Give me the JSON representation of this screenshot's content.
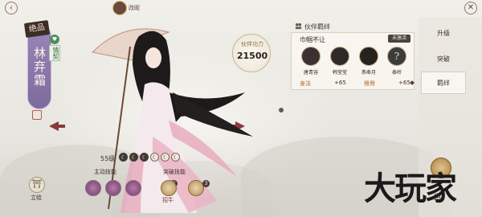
{
  "topbar": {
    "player_name": "改昵",
    "back_icon": "back-icon",
    "close_icon": "close-icon"
  },
  "character": {
    "rarity": "绝品",
    "name": "林弃霜",
    "affinity_label": "情契",
    "level": "55级",
    "star_glyph": "☾",
    "stars_filled": 3,
    "stars_total": 6
  },
  "power": {
    "label": "伙伴功力",
    "value": "21500"
  },
  "skills": {
    "active_label": "主动技能",
    "breakthrough_label": "突破技能",
    "active_badge": "2",
    "break_badge": "3",
    "break_text": "招牛"
  },
  "portrait": {
    "label": "立绘",
    "icon": "portrait-icon"
  },
  "bond_panel": {
    "title": "伙伴羁绊",
    "bond_name": "巾帼不让",
    "status": "未激活",
    "members": [
      "唐青容",
      "韩莹莹",
      "燕奉月",
      "泰岭"
    ],
    "stats": [
      {
        "name": "身法",
        "value": "+65"
      },
      {
        "name": "根骨",
        "value": "+65"
      }
    ]
  },
  "tabs": [
    {
      "label": "升级",
      "active": false
    },
    {
      "label": "突破",
      "active": false
    },
    {
      "label": "羁绊",
      "active": true
    }
  ],
  "bottom_right": {
    "label": "招"
  },
  "watermark": "大玩家"
}
